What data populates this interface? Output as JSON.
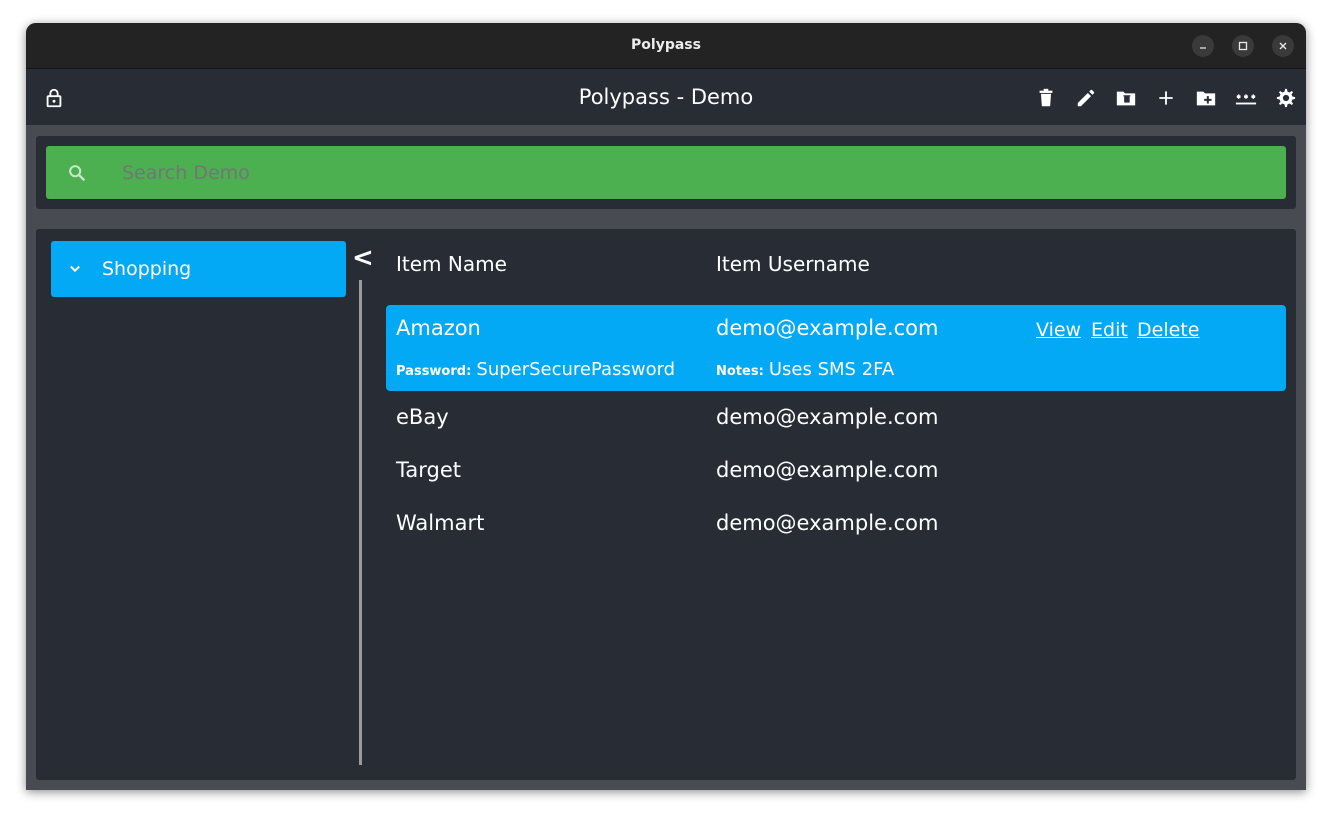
{
  "window": {
    "title": "Polypass"
  },
  "header": {
    "title": "Polypass - Demo"
  },
  "search": {
    "placeholder": "Search Demo"
  },
  "sidebar": {
    "folders": [
      {
        "label": "Shopping"
      }
    ]
  },
  "collapse_label": "<",
  "table": {
    "headers": [
      "Item Name",
      "Item Username"
    ],
    "rows": [
      {
        "name": "Amazon",
        "username": "demo@example.com",
        "password_label": "Password:",
        "password": "SuperSecurePassword",
        "notes_label": "Notes:",
        "notes": "Uses SMS 2FA",
        "actions": [
          "View",
          "Edit",
          "Delete"
        ]
      },
      {
        "name": "eBay",
        "username": "demo@example.com"
      },
      {
        "name": "Target",
        "username": "demo@example.com"
      },
      {
        "name": "Walmart",
        "username": "demo@example.com"
      }
    ]
  },
  "colors": {
    "search_bg": "#4caf50",
    "accent": "#03a9f4",
    "panel_bg": "#282c34"
  }
}
